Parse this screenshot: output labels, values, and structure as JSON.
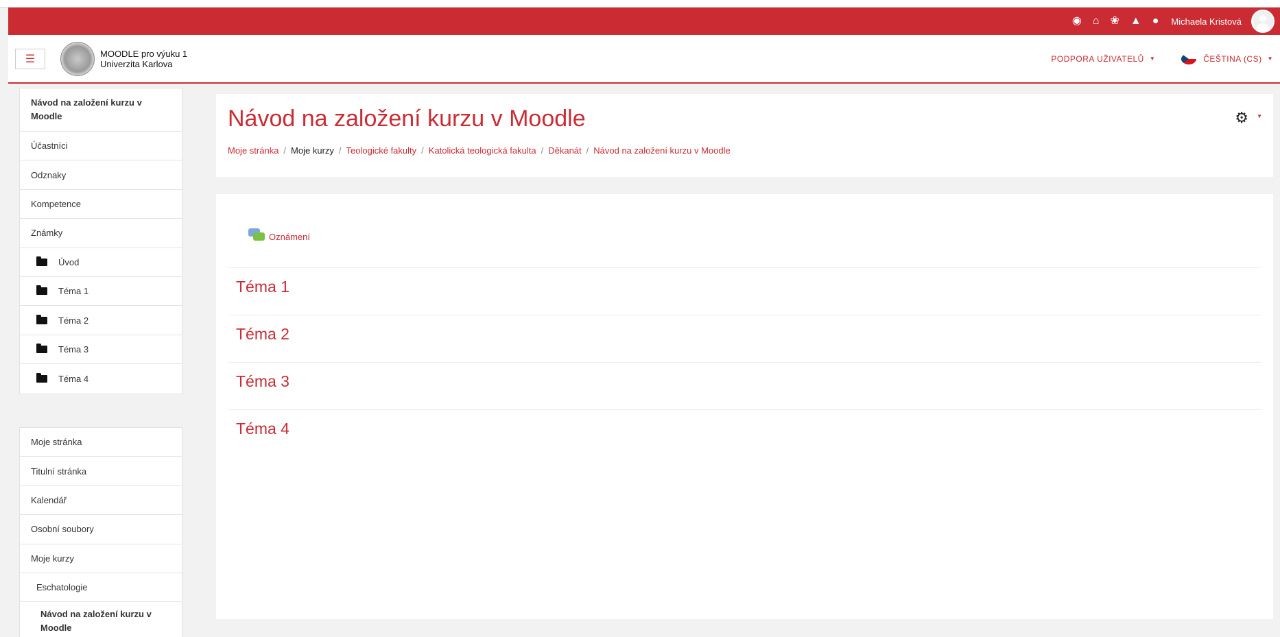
{
  "topbar": {
    "icons": [
      "dashboard-icon",
      "home-icon",
      "cubes-icon",
      "bell-icon",
      "chat-icon"
    ],
    "user_name": "Michaela Kristová"
  },
  "navbar": {
    "brand_line1": "MOODLE pro výuku 1",
    "brand_line2": "Univerzita Karlova",
    "support_label": "PODPORA UŽIVATELŮ",
    "language_label": "ČEŠTINA (CS)"
  },
  "sidebar_course": {
    "items": [
      {
        "label": "Návod na založení kurzu v Moodle"
      },
      {
        "label": "Účastníci"
      },
      {
        "label": "Odznaky"
      },
      {
        "label": "Kompetence"
      },
      {
        "label": "Známky"
      },
      {
        "label": "Úvod"
      },
      {
        "label": "Téma 1"
      },
      {
        "label": "Téma 2"
      },
      {
        "label": "Téma 3"
      },
      {
        "label": "Téma 4"
      }
    ]
  },
  "sidebar_site": {
    "items": [
      {
        "label": "Moje stránka"
      },
      {
        "label": "Titulní stránka"
      },
      {
        "label": "Kalendář"
      },
      {
        "label": "Osobní soubory"
      },
      {
        "label": "Moje kurzy"
      },
      {
        "label": "Eschatologie"
      },
      {
        "label": "Návod na založení kurzu v Moodle"
      }
    ]
  },
  "header": {
    "title": "Návod na založení kurzu v Moodle",
    "breadcrumb": [
      "Moje stránka",
      "Moje kurzy",
      "Teologické fakulty",
      "Katolická teologická fakulta",
      "Děkanát",
      "Návod na založení kurzu v Moodle"
    ],
    "separator": "/"
  },
  "content": {
    "news_label": "Oznámení",
    "sections": [
      "Téma 1",
      "Téma 2",
      "Téma 3",
      "Téma 4"
    ]
  },
  "colors": {
    "accent": "#cb2b33"
  }
}
